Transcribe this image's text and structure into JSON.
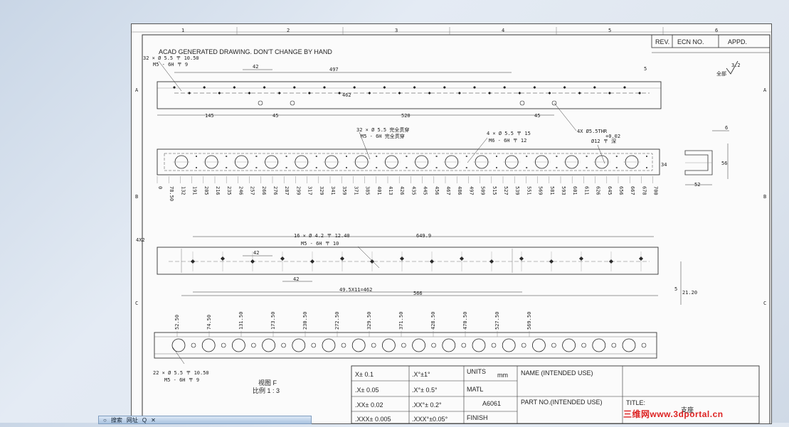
{
  "drawing": {
    "note": "ACAD GENERATED DRAWING. DON'T CHANGE BY HAND",
    "zone_numbers": [
      "1",
      "2",
      "3",
      "4",
      "5",
      "6"
    ],
    "zone_letters": [
      "A",
      "B",
      "C"
    ],
    "rev_block": {
      "rev": "REV.",
      "ecn": "ECN NO.",
      "appd": "APPD."
    },
    "roughness": "3.2",
    "roughness_prefix": "全部",
    "view_label": "视图 F",
    "scale_label": "比例 1 : 3"
  },
  "view1": {
    "callout_top": "32 × Ø 5.5 〒 10.50",
    "callout_sub": "M5 - 6H 〒 9",
    "dim_42": "42",
    "dim_497": "497",
    "dim_462": "462",
    "dim_5": "5",
    "dim_145": "145",
    "dim_45a": "45",
    "dim_520": "520",
    "dim_45b": "45",
    "callout_tapped": "4X Ø5.5THR"
  },
  "view2": {
    "callout_a": "32 × Ø 5.5 完全贯穿",
    "callout_a_sub": "M5 - 6H 完全贯穿",
    "callout_b": "4 × Ø 5.5 〒 15",
    "callout_b_sub": "M6 - 6H 〒 12",
    "callout_c": "Ø12  〒 深",
    "callout_c_tol": "+0.02",
    "section_w": "6",
    "section_h": "56",
    "section_bot": "52",
    "section_left": "34",
    "ordinates": [
      "0",
      "78.50",
      "132",
      "191",
      "205",
      "216",
      "235",
      "246",
      "257",
      "266",
      "276",
      "287",
      "299",
      "317",
      "329",
      "341",
      "359",
      "371",
      "385",
      "401",
      "413",
      "426",
      "435",
      "445",
      "456",
      "467",
      "486",
      "497",
      "509",
      "515",
      "527",
      "539",
      "551",
      "569",
      "581",
      "593",
      "601",
      "611",
      "626",
      "645",
      "656",
      "667",
      "678",
      "700"
    ]
  },
  "view3": {
    "corner": "4X2",
    "callout": "16 × Ø 4.2 〒 12.40",
    "callout_sub": "M5 - 6H 〒 10",
    "dim_649": "649.9",
    "dim_42a": "42",
    "dim_42b": "42",
    "dim_chain": "49.5X11=462",
    "dim_566": "566",
    "dim_5": "5",
    "dim_21": "21.20"
  },
  "view4": {
    "ordinates": [
      "52.50",
      "74.50",
      "131.50",
      "173.50",
      "230.50",
      "272.50",
      "329.50",
      "371.50",
      "428.50",
      "470.50",
      "527.50",
      "569.50"
    ],
    "callout": "22 × Ø 5.5 〒 10.50",
    "callout_sub": "M5 - 6H 〒 9"
  },
  "title_block": {
    "tol_x": "X± 0.1",
    "tol_ang1": ".X°±1°",
    "tol_xx": ".X± 0.05",
    "tol_ang2": ".X°± 0.5°",
    "tol_xxx": ".XX± 0.02",
    "tol_ang3": ".XX°± 0.2°",
    "tol_xxxx": ".XXX± 0.005",
    "tol_ang4": ".XXX°±0.05°",
    "units": "UNITS",
    "units_val": "mm",
    "matl": "MATL",
    "matl_val": "A6061",
    "finish": "FINISH",
    "name_label": "NAME (INTENDED USE)",
    "partno_label": "PART NO.(INTENDED USE)",
    "title_label": "TITLE:",
    "title_val": "支座"
  },
  "taskbar": {
    "search": "搜索",
    "web": "网址",
    "extra": "Q"
  },
  "watermark": "三维网www.3dportal.cn"
}
